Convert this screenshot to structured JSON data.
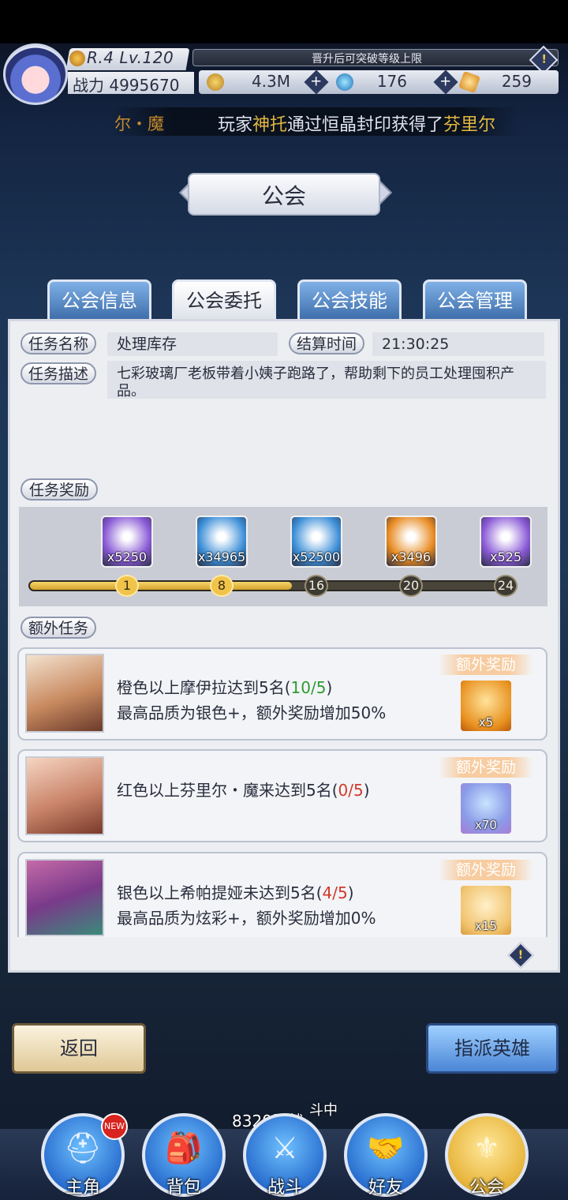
{
  "header": {
    "rank": "R.4 Lv.120",
    "power_label": "战力",
    "power_value": "4995670",
    "exp_text": "晋升后可突破等级上限",
    "gold": "4.3M",
    "gems": "176",
    "crystals": "259"
  },
  "marquee": {
    "prefix": "尔・魔",
    "text_1": "玩家",
    "name": "神托",
    "text_2": "通过恒晶封印获得了",
    "hero": "芬里尔"
  },
  "title": "公会",
  "tabs": [
    {
      "label": "公会信息"
    },
    {
      "label": "公会委托"
    },
    {
      "label": "公会技能"
    },
    {
      "label": "公会管理"
    }
  ],
  "task": {
    "name_label": "任务名称",
    "name_value": "处理库存",
    "time_label": "结算时间",
    "time_value": "21:30:25",
    "desc_label": "任务描述",
    "desc_value": "七彩玻璃厂老板带着小姨子跑路了，帮助剩下的员工处理囤积产品。",
    "reward_label": "任务奖励",
    "extra_label": "额外任务"
  },
  "rewards": [
    {
      "icon": "gold-bag-icon",
      "count": "x5250",
      "color": "#8a5ad6"
    },
    {
      "icon": "ice-crystal-icon",
      "count": "x34965",
      "color": "#3d8fd8"
    },
    {
      "icon": "blue-potion-icon",
      "count": "x52500",
      "color": "#3d8fd8"
    },
    {
      "icon": "orange-gem-icon",
      "count": "x3496",
      "color": "#e88a20"
    },
    {
      "icon": "rainbow-orb-icon",
      "count": "x525",
      "color": "#8a5ad6"
    }
  ],
  "progress": {
    "fraction": 0.54,
    "nodes": [
      "1",
      "8",
      "16",
      "20",
      "24"
    ],
    "reached": 2
  },
  "extra_tasks": [
    {
      "portrait": "hero-portrait-moira",
      "line1_a": "橙色以上摩伊拉达到5名(",
      "line1_b": "10/5",
      "line1_c": ")",
      "line2": "最高品质为银色+，额外奖励增加50%",
      "bonus_label": "额外奖励",
      "bonus_icon": "gold-crystal-icon",
      "bonus_count": "x5"
    },
    {
      "portrait": "hero-portrait-fenrir",
      "line1_a": "红色以上芬里尔・魔来达到5名(",
      "line1_b": "0/5",
      "line1_c": ")",
      "line2": "",
      "bonus_label": "额外奖励",
      "bonus_icon": "blue-diamond-icon",
      "bonus_count": "x70"
    },
    {
      "portrait": "hero-portrait-hypatia",
      "line1_a": "银色以上希帕提娅未达到5名(",
      "line1_b": "4/5",
      "line1_c": ")",
      "line2": "最高品质为炫彩+，额外奖励增加0%",
      "bonus_label": "额外奖励",
      "bonus_icon": "gold-crystal-icon",
      "bonus_count": "x15"
    }
  ],
  "buttons": {
    "back": "返回",
    "assign": "指派英雄"
  },
  "nav": {
    "battle_info": "8320层战",
    "battle_sub": "斗中",
    "new_badge": "NEW",
    "items": [
      {
        "label": "主角",
        "icon": "helmet-icon"
      },
      {
        "label": "背包",
        "icon": "backpack-icon"
      },
      {
        "label": "战斗",
        "icon": "crossed-swords-icon"
      },
      {
        "label": "好友",
        "icon": "handshake-icon"
      },
      {
        "label": "公会",
        "icon": "guild-crest-icon"
      }
    ]
  }
}
